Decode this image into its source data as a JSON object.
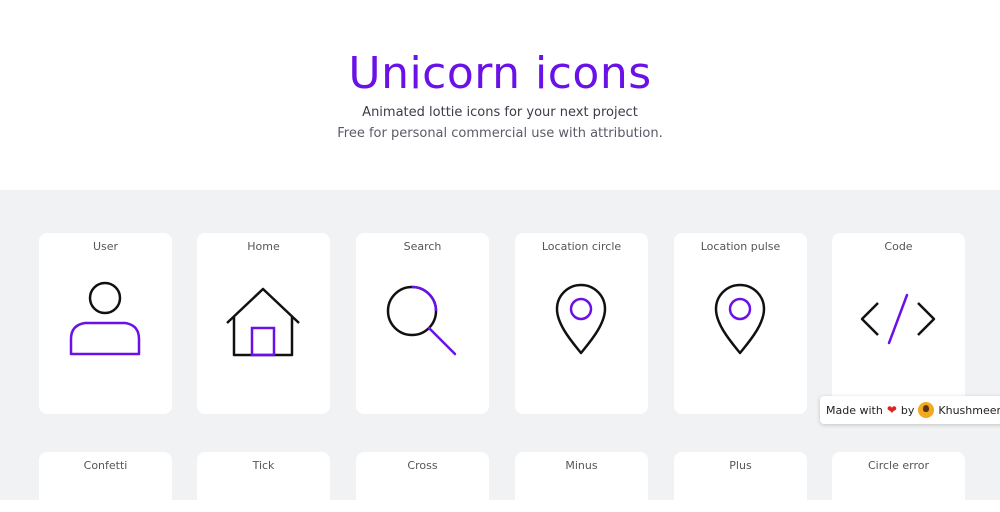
{
  "hero": {
    "title": "Unicorn icons",
    "subtitle": "Animated lottie icons for your next project",
    "license": "Free for personal commercial use with attribution."
  },
  "icons_row1": [
    {
      "label": "User",
      "icon": "user-icon"
    },
    {
      "label": "Home",
      "icon": "home-icon"
    },
    {
      "label": "Search",
      "icon": "search-icon"
    },
    {
      "label": "Location circle",
      "icon": "location-circle-icon"
    },
    {
      "label": "Location pulse",
      "icon": "location-pulse-icon"
    },
    {
      "label": "Code",
      "icon": "code-icon"
    }
  ],
  "icons_row2": [
    {
      "label": "Confetti"
    },
    {
      "label": "Tick"
    },
    {
      "label": "Cross"
    },
    {
      "label": "Minus"
    },
    {
      "label": "Plus"
    },
    {
      "label": "Circle error"
    }
  ],
  "badge": {
    "made_with": "Made with",
    "by": "by",
    "author": "Khushmeen",
    "heart_icon": "heart-icon"
  },
  "colors": {
    "accent": "#6a11e8",
    "stroke": "#111111",
    "background": "#f1f2f4"
  }
}
